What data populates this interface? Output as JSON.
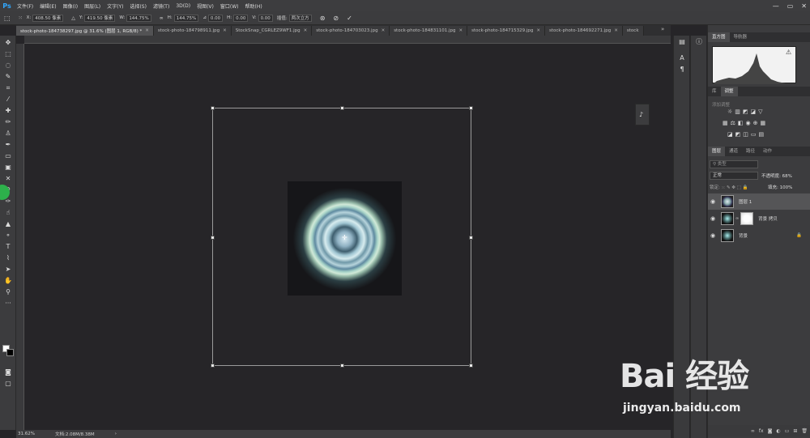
{
  "menu": {
    "logo": "Ps",
    "items": [
      "文件(F)",
      "编辑(E)",
      "图像(I)",
      "图层(L)",
      "文字(Y)",
      "选择(S)",
      "滤镜(T)",
      "3D(D)",
      "视图(V)",
      "窗口(W)",
      "帮助(H)"
    ]
  },
  "window_controls": {
    "minimize": "—",
    "maximize": "▭",
    "close": "✕"
  },
  "options": {
    "x_label": "X:",
    "x_value": "408.50 像素",
    "y_label": "Y:",
    "y_value": "419.50 像素",
    "w_label": "W:",
    "w_value": "144.75%",
    "h_label": "H:",
    "h_value": "144.75%",
    "angle_value": "0.00",
    "hskew_label": "H:",
    "hskew_value": "0.00",
    "vskew_label": "V:",
    "vskew_value": "0.00",
    "interp_label": "插值:",
    "interp_value": "两次立方"
  },
  "tabs": [
    {
      "label": "stock-photo-184738297.jpg @ 31.6% (图层 1, RGB/8) *",
      "active": true
    },
    {
      "label": "stock-photo-184798911.jpg"
    },
    {
      "label": "StockSnap_CGRLEZ9WF1.jpg"
    },
    {
      "label": "stock-photo-184703023.jpg"
    },
    {
      "label": "stock-photo-184831101.jpg"
    },
    {
      "label": "stock-photo-184715329.jpg"
    },
    {
      "label": "stock-photo-184692271.jpg"
    },
    {
      "label": "stock"
    }
  ],
  "tab_overflow": "»",
  "status": {
    "zoom": "31.62%",
    "doc": "文档:2.08M/8.38M"
  },
  "panels": {
    "histogram_tabs": [
      "直方图",
      "导航器"
    ],
    "adjust_tabs": [
      "库",
      "调整"
    ],
    "adjust_hint": "添加调整",
    "layers_tabs": [
      "图层",
      "通道",
      "路径",
      "动作"
    ],
    "filter_placeholder": "类型",
    "blend_mode": "正常",
    "opacity_label": "不透明度:",
    "opacity_value": "68%",
    "lock_label": "锁定:",
    "fill_label": "填充:",
    "fill_value": "100%",
    "layers": [
      {
        "name": "图层 1",
        "selected": true
      },
      {
        "name": "背景 拷贝"
      },
      {
        "name": "背景",
        "locked": true
      }
    ]
  },
  "watermark": {
    "brand": "Bai 经验",
    "url": "jingyan.baidu.com"
  }
}
